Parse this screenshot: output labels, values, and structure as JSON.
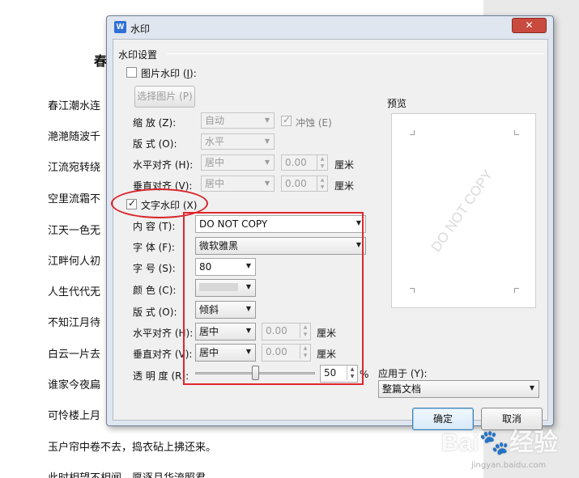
{
  "document": {
    "title": "春",
    "lines": [
      "春江潮水连",
      "滟滟随波千",
      "江流宛转绕",
      "空里流霜不",
      "江天一色无",
      "江畔何人初",
      "人生代代无",
      "不知江月待",
      "白云一片去",
      "谁家今夜扁",
      "可怜楼上月",
      "玉户帘中卷不去，捣衣砧上拂还来。",
      "此时相望不相闻，愿逐月华流照君。"
    ]
  },
  "dialog": {
    "icon_label": "W",
    "title": "水印",
    "close_label": "✕",
    "group_label": "水印设置",
    "picture_watermark": {
      "label": "图片水印 (",
      "key": "I",
      "suffix": "):",
      "checked": false,
      "select_button": "选择图片 (P)",
      "scale_label": "缩    放 (Z):",
      "scale_value": "自动",
      "washout_label": "冲蚀 (E)",
      "washout_checked": true,
      "layout_label": "版    式 (O):",
      "layout_value": "水平",
      "halign_label": "水平对齐 (H):",
      "halign_value": "居中",
      "halign_offset": "0.00",
      "valign_label": "垂直对齐 (V):",
      "valign_value": "居中",
      "valign_offset": "0.00",
      "unit": "厘米"
    },
    "text_watermark": {
      "label": "文字水印 (X)",
      "checked": true,
      "content_label": "内    容 (T):",
      "content_value": "DO NOT COPY",
      "font_label": "字    体 (F):",
      "font_value": "微软雅黑",
      "size_label": "字    号 (S):",
      "size_value": "80",
      "color_label": "颜    色 (C):",
      "color_value": "#d7d7d7",
      "layout_label": "版    式 (O):",
      "layout_value": "倾斜",
      "halign_label": "水平对齐 (H):",
      "halign_value": "居中",
      "halign_offset": "0.00",
      "valign_label": "垂直对齐 (V):",
      "valign_value": "居中",
      "valign_offset": "0.00",
      "unit": "厘米",
      "transparency_label": "透  明  度 (R):",
      "transparency_value": "50",
      "transparency_unit": "%"
    },
    "preview": {
      "label": "预览",
      "watermark_text": "DO NOT COPY"
    },
    "apply_to_label": "应用于 (Y):",
    "apply_to_value": "整篇文档",
    "ok_label": "确定",
    "cancel_label": "取消"
  },
  "watermark": {
    "brand": "Bai",
    "brand2": "经验",
    "url": "jingyan.baidu.com"
  },
  "colors": {
    "annotation_red": "#e0262d",
    "dialog_bg": "#dfe6ef"
  }
}
